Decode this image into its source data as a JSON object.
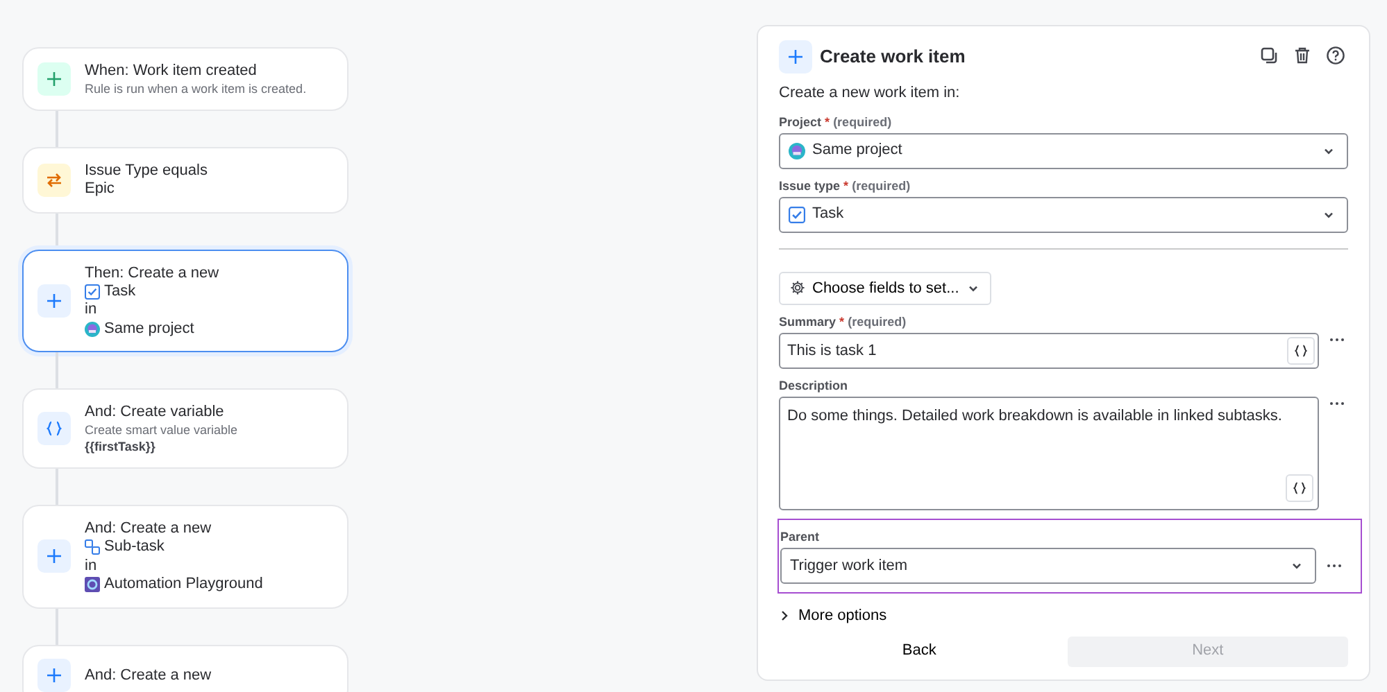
{
  "steps": [
    {
      "kind": "trigger",
      "selected": false,
      "title": "When: Work item created",
      "lines": [
        {
          "kind": "sub",
          "text": "Rule is run when a work item is created."
        }
      ]
    },
    {
      "kind": "condition",
      "selected": false,
      "title": "Issue Type equals",
      "lines": [
        {
          "kind": "text",
          "text": "Epic"
        }
      ]
    },
    {
      "kind": "action",
      "selected": true,
      "title": "Then: Create a new",
      "lines": [
        {
          "kind": "task",
          "text": "Task"
        },
        {
          "kind": "text",
          "text": "in"
        },
        {
          "kind": "project",
          "text": "Same project"
        }
      ]
    },
    {
      "kind": "variable",
      "selected": false,
      "title": "And: Create variable",
      "lines": [
        {
          "kind": "sub",
          "text": "Create smart value variable"
        },
        {
          "kind": "code",
          "text": "{{firstTask}}"
        }
      ]
    },
    {
      "kind": "action",
      "selected": false,
      "title": "And: Create a new",
      "lines": [
        {
          "kind": "subtask",
          "text": "Sub-task"
        },
        {
          "kind": "text",
          "text": "in"
        },
        {
          "kind": "playground",
          "text": "Automation Playground"
        }
      ]
    },
    {
      "kind": "action",
      "selected": false,
      "title": "And: Create a new"
    }
  ],
  "panel": {
    "title": "Create work item",
    "intro": "Create a new work item in:",
    "fields": [
      {
        "kind": "select",
        "label": "Project",
        "required_mark": "*",
        "hint": "(required)",
        "value": "Same project"
      },
      {
        "kind": "select",
        "label": "Issue type",
        "required_mark": "*",
        "hint": "(required)",
        "value": "Task"
      },
      {
        "kind": "divider"
      },
      {
        "kind": "menu",
        "value": "Choose fields to set..."
      },
      {
        "kind": "input",
        "label": "Summary",
        "required_mark": "*",
        "hint": "(required)",
        "value": "This is task 1"
      },
      {
        "kind": "textarea",
        "label": "Description",
        "value": "Do some things. Detailed work breakdown is available in linked subtasks."
      },
      {
        "kind": "select",
        "label": "Parent",
        "value": "Trigger work item",
        "highlighted": true
      }
    ],
    "more_options": {
      "label": "More options",
      "expanded": false
    },
    "buttons": [
      {
        "label": "Back",
        "disabled": false
      },
      {
        "label": "Next",
        "disabled": true
      }
    ]
  }
}
